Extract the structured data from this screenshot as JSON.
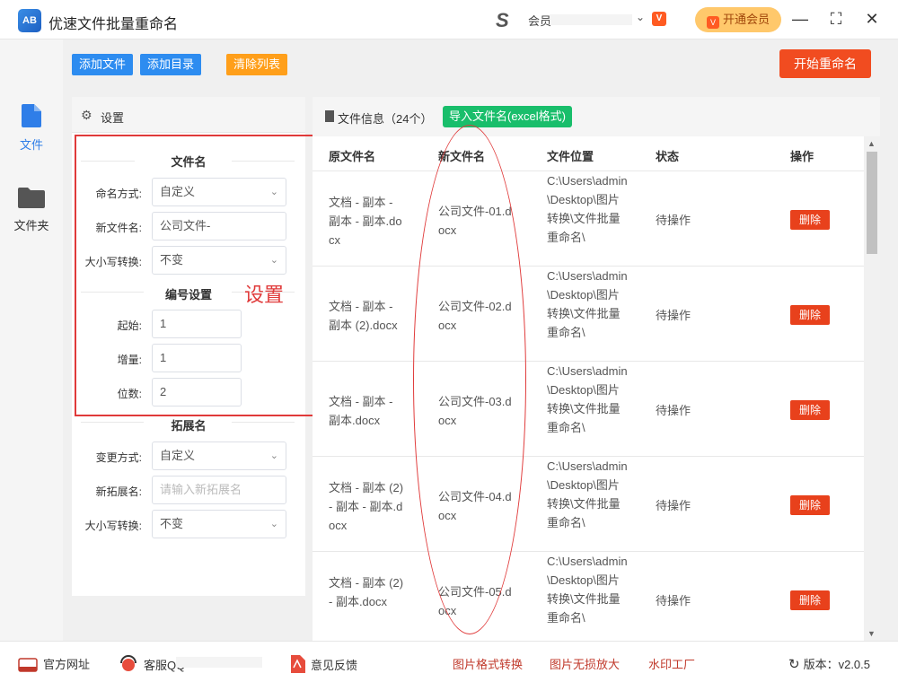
{
  "app": {
    "title": "优速文件批量重命名",
    "logo_text": "AB"
  },
  "account": {
    "name_prefix": "会员",
    "vip_button": "开通会员"
  },
  "window": {
    "minimize": "—",
    "maximize": "⛶",
    "close": "✕"
  },
  "nav": [
    {
      "label": "文件"
    },
    {
      "label": "文件夹"
    }
  ],
  "toolbar": {
    "add_file": "添加文件",
    "add_dir": "添加目录",
    "clear_list": "清除列表",
    "start": "开始重命名"
  },
  "settings": {
    "title": "设置",
    "filename_section": "文件名",
    "naming_label": "命名方式:",
    "naming_value": "自定义",
    "newname_label": "新文件名:",
    "newname_value": "公司文件-",
    "case_label": "大小写转换:",
    "case_value": "不变",
    "number_section": "编号设置",
    "start_label": "起始:",
    "start_value": "1",
    "step_label": "增量:",
    "step_value": "1",
    "digits_label": "位数:",
    "digits_value": "2",
    "ext_section": "拓展名",
    "change_label": "变更方式:",
    "change_value": "自定义",
    "newext_label": "新拓展名:",
    "newext_placeholder": "请输入新拓展名",
    "ext_case_label": "大小写转换:",
    "ext_case_value": "不变",
    "annotation": "设置"
  },
  "files": {
    "title": "文件信息（24个）",
    "import_button": "导入文件名(excel格式)",
    "columns": [
      "原文件名",
      "新文件名",
      "文件位置",
      "状态",
      "操作"
    ],
    "rows": [
      {
        "orig": "文档 - 副本 - 副本 - 副本.docx",
        "new": "公司文件-01.docx",
        "loc": "C:\\Users\\admin\\Desktop\\图片转换\\文件批量重命名\\",
        "status": "待操作",
        "action": "删除"
      },
      {
        "orig": "文档 - 副本 - 副本 (2).docx",
        "new": "公司文件-02.docx",
        "loc": "C:\\Users\\admin\\Desktop\\图片转换\\文件批量重命名\\",
        "status": "待操作",
        "action": "删除"
      },
      {
        "orig": "文档 - 副本 - 副本.docx",
        "new": "公司文件-03.docx",
        "loc": "C:\\Users\\admin\\Desktop\\图片转换\\文件批量重命名\\",
        "status": "待操作",
        "action": "删除"
      },
      {
        "orig": "文档 - 副本 (2) - 副本 - 副本.docx",
        "new": "公司文件-04.docx",
        "loc": "C:\\Users\\admin\\Desktop\\图片转换\\文件批量重命名\\",
        "status": "待操作",
        "action": "删除"
      },
      {
        "orig": "文档 - 副本 (2) - 副本.docx",
        "new": "公司文件-05.docx",
        "loc": "C:\\Users\\admin\\Desktop\\图片转换\\文件批量重命名\\",
        "status": "待操作",
        "action": "删除"
      }
    ]
  },
  "footer": {
    "website": "官方网址",
    "support": "客服QQ",
    "feedback": "意见反馈",
    "link1": "图片格式转换",
    "link2": "图片无损放大",
    "link3": "水印工厂",
    "version_label": "版本：",
    "version": "v2.0.5"
  },
  "colors": {
    "primary": "#2d8cf0",
    "start": "#f14c20",
    "import": "#19be6b",
    "annotation": "#e03a3a"
  }
}
